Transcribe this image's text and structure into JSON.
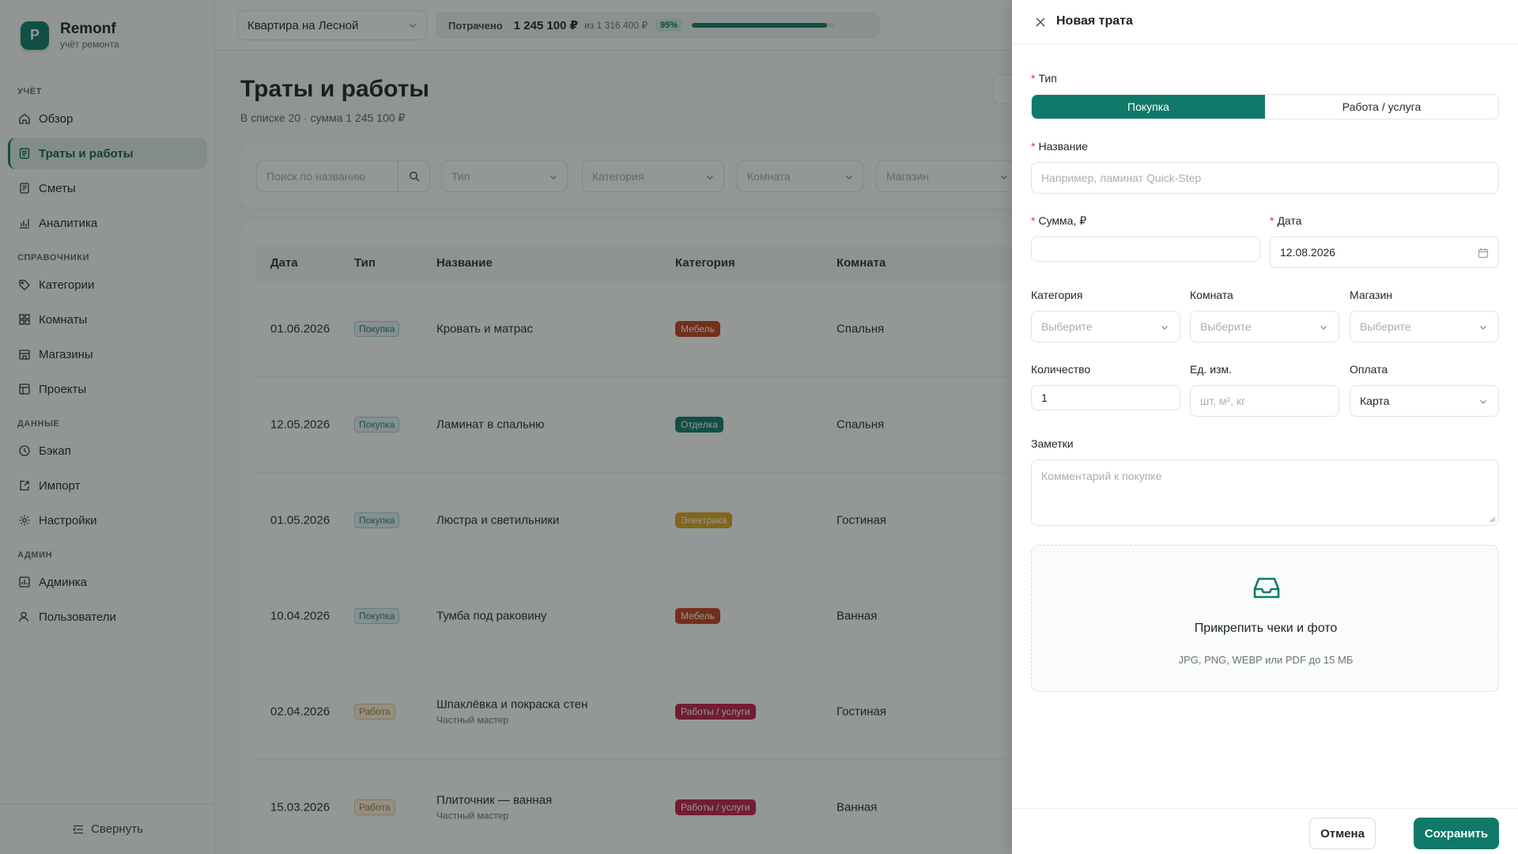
{
  "brand": {
    "logo_letter": "Р",
    "name": "Remonf",
    "subtitle": "учёт ремонта"
  },
  "nav": {
    "sections": [
      "УЧЁТ",
      "СПРАВОЧНИКИ",
      "ДАННЫЕ",
      "АДМИН"
    ],
    "items": [
      "Обзор",
      "Траты и работы",
      "Сметы",
      "Аналитика",
      "Категории",
      "Комнаты",
      "Магазины",
      "Проекты",
      "Бэкап",
      "Импорт",
      "Настройки",
      "Админка",
      "Пользователи"
    ],
    "collapse": "Свернуть"
  },
  "topbar": {
    "project": "Квартира на Лесной",
    "budget_label": "Потрачено",
    "spent": "1 245 100 ₽",
    "of": "из 1 316 400 ₽",
    "pct": "95%",
    "progress": 0.95
  },
  "page": {
    "title": "Траты и работы",
    "subtitle": "В списке 20 · сумма 1 245 100 ₽"
  },
  "filters": {
    "search_placeholder": "Поиск по названию",
    "type": "Тип",
    "category": "Категория",
    "room": "Комната",
    "shop": "Магазин"
  },
  "table": {
    "headers": [
      "Дата",
      "Тип",
      "Название",
      "Категория",
      "Комната"
    ],
    "rows": [
      {
        "date": "01.06.2026",
        "type": "Покупка",
        "type_kind": "buy",
        "name": "Кровать и матрас",
        "sub": "",
        "cat": "Мебель",
        "cat_color": "#c4401d",
        "room": "Спальня"
      },
      {
        "date": "12.05.2026",
        "type": "Покупка",
        "type_kind": "buy",
        "name": "Ламинат в спальню",
        "sub": "",
        "cat": "Отделка",
        "cat_color": "#0f7a69",
        "room": "Спальня"
      },
      {
        "date": "01.05.2026",
        "type": "Покупка",
        "type_kind": "buy",
        "name": "Люстра и светильники",
        "sub": "",
        "cat": "Электрика",
        "cat_color": "#e0a31a",
        "room": "Гостиная"
      },
      {
        "date": "10.04.2026",
        "type": "Покупка",
        "type_kind": "buy",
        "name": "Тумба под раковину",
        "sub": "",
        "cat": "Мебель",
        "cat_color": "#c4401d",
        "room": "Ванная"
      },
      {
        "date": "02.04.2026",
        "type": "Работа",
        "type_kind": "work",
        "name": "Шпаклёвка и покраска стен",
        "sub": "Частный мастер",
        "cat": "Работы / услуги",
        "cat_color": "#c21e4a",
        "room": "Гостиная"
      },
      {
        "date": "15.03.2026",
        "type": "Работа",
        "type_kind": "work",
        "name": "Плиточник — ванная",
        "sub": "Частный мастер",
        "cat": "Работы / услуги",
        "cat_color": "#c21e4a",
        "room": "Ванная"
      }
    ]
  },
  "drawer": {
    "title": "Новая трата",
    "type_label": "Тип",
    "type_buy": "Покупка",
    "type_work": "Работа / услуга",
    "name_label": "Название",
    "name_placeholder": "Например, ламинат Quick-Step",
    "sum_label": "Сумма, ₽",
    "date_label": "Дата",
    "date_value": "12.08.2026",
    "category_label": "Категория",
    "room_label": "Комната",
    "shop_label": "Магазин",
    "choose": "Выберите",
    "qty_label": "Количество",
    "qty_value": "1",
    "unit_label": "Ед. изм.",
    "unit_placeholder": "шт, м², кг",
    "pay_label": "Оплата",
    "pay_value": "Карта",
    "notes_label": "Заметки",
    "notes_placeholder": "Комментарий к покупке",
    "attach_title": "Прикрепить чеки и фото",
    "attach_hint": "JPG, PNG, WEBP или PDF до 15 МБ",
    "cancel": "Отмена",
    "save": "Сохранить"
  },
  "colors": {
    "accent": "#0f7a69"
  }
}
